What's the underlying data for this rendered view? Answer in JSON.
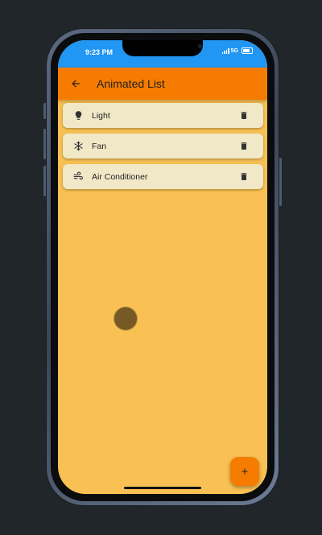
{
  "status_bar": {
    "time": "9:23 PM",
    "network": "5G",
    "background_color": "#2196f3"
  },
  "app_bar": {
    "title": "Animated List",
    "back_icon": "arrow-back-icon",
    "background_color": "#f57c00"
  },
  "items": [
    {
      "label": "Light",
      "icon": "lightbulb-icon",
      "action_icon": "trash-icon"
    },
    {
      "label": "Fan",
      "icon": "snowflake-icon",
      "action_icon": "trash-icon"
    },
    {
      "label": "Air Conditioner",
      "icon": "air-flow-icon",
      "action_icon": "trash-icon"
    }
  ],
  "fab": {
    "icon": "plus-icon",
    "background_color": "#f57c00"
  },
  "colors": {
    "screen_background": "#f9c153",
    "card_background": "#f1e8c7"
  }
}
